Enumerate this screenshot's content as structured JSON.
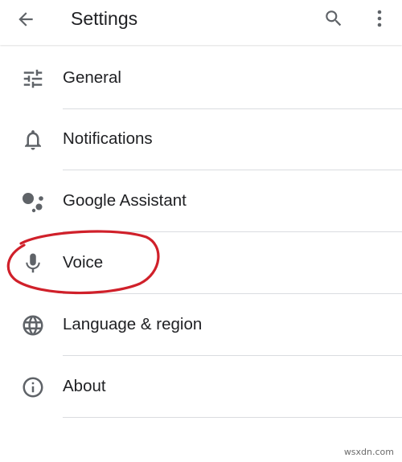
{
  "appbar": {
    "title": "Settings",
    "back_icon": "arrow-back-icon",
    "search_icon": "search-icon",
    "more_icon": "more-vert-icon"
  },
  "items": [
    {
      "label": "General",
      "icon": "tune-icon"
    },
    {
      "label": "Notifications",
      "icon": "bell-icon"
    },
    {
      "label": "Google Assistant",
      "icon": "assistant-icon"
    },
    {
      "label": "Voice",
      "icon": "mic-icon"
    },
    {
      "label": "Language & region",
      "icon": "globe-icon"
    },
    {
      "label": "About",
      "icon": "info-icon"
    }
  ],
  "annotation": {
    "color": "#d0202a"
  },
  "colors": {
    "icon": "#5f6368",
    "text": "#202124",
    "divider": "#dadce0"
  },
  "watermark": "wsxdn.com"
}
